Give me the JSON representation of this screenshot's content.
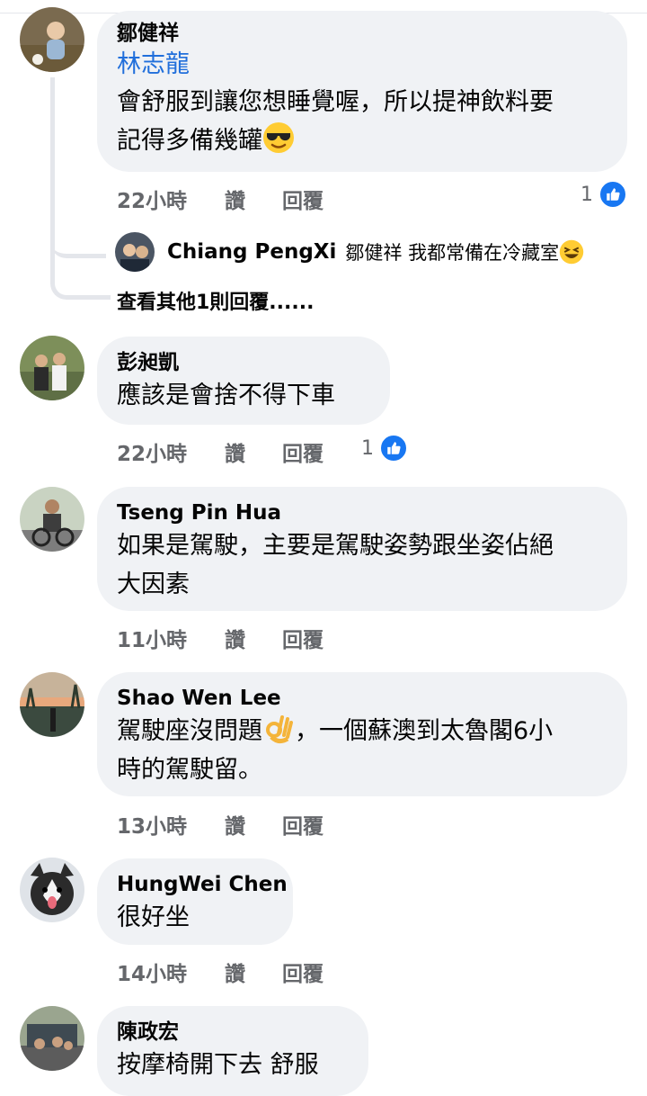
{
  "comments": [
    {
      "author": "鄒健祥",
      "mention": "林志龍",
      "text_lines": [
        "會舒服到讓您想睡覺喔，所以提神飲料要",
        "記得多備幾罐"
      ],
      "time": "22小時",
      "like": "讚",
      "reply": "回覆",
      "reactions": "1",
      "emoji": "sunglasses-emoji"
    },
    {
      "author": "彭昶凱",
      "text_lines": [
        "應該是會捨不得下車"
      ],
      "time": "22小時",
      "like": "讚",
      "reply": "回覆",
      "reactions": "1"
    },
    {
      "author": "Tseng Pin Hua",
      "text_lines": [
        "如果是駕駛，主要是駕駛姿勢跟坐姿佔絕",
        "大因素"
      ],
      "time": "11小時",
      "like": "讚",
      "reply": "回覆"
    },
    {
      "author": "Shao Wen Lee",
      "text_lines": [
        "駕駛座沒問題",
        "，一個蘇澳到太魯閣6小",
        "時的駕駛留。"
      ],
      "time": "13小時",
      "like": "讚",
      "reply": "回覆",
      "emoji": "ok-hand-emoji"
    },
    {
      "author": "HungWei Chen",
      "text_lines": [
        "很好坐"
      ],
      "time": "14小時",
      "like": "讚",
      "reply": "回覆"
    },
    {
      "author": "陳政宏",
      "text_lines": [
        "按摩椅開下去 舒服"
      ]
    }
  ],
  "nested_reply": {
    "author": "Chiang PengXi",
    "text": "鄒健祥 我都常備在冷藏室",
    "emoji": "laughing-emoji"
  },
  "more_replies": "查看其他1則回覆......",
  "colors": {
    "bubble": "#f0f2f5",
    "link": "#216fdb",
    "meta": "#65676b",
    "like_badge": "#1877f2"
  }
}
